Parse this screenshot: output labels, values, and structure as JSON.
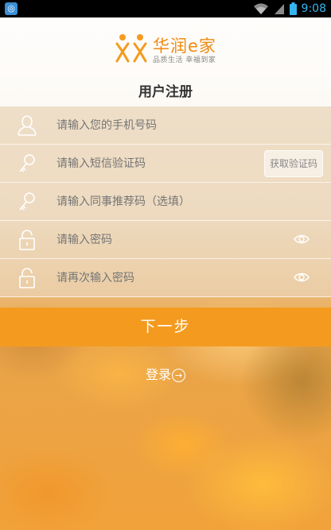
{
  "status_bar": {
    "time": "9:08",
    "app_icon": "gallery-icon"
  },
  "brand": {
    "name": "华润e家",
    "slogan": "品质生活  幸福到家",
    "accent": "#f08a10"
  },
  "title": "用户注册",
  "form": {
    "phone_placeholder": "请输入您的手机号码",
    "sms_placeholder": "请输入短信验证码",
    "get_code_label": "获取验证码",
    "referral_placeholder": "请输入同事推荐码（选填）",
    "password_placeholder": "请输入密码",
    "password_confirm_placeholder": "请再次输入密码"
  },
  "next_button": {
    "label": "下一步",
    "color": "#f49b1f"
  },
  "login_link": {
    "label": "登录",
    "icon": "arrow-right-circle-icon"
  }
}
